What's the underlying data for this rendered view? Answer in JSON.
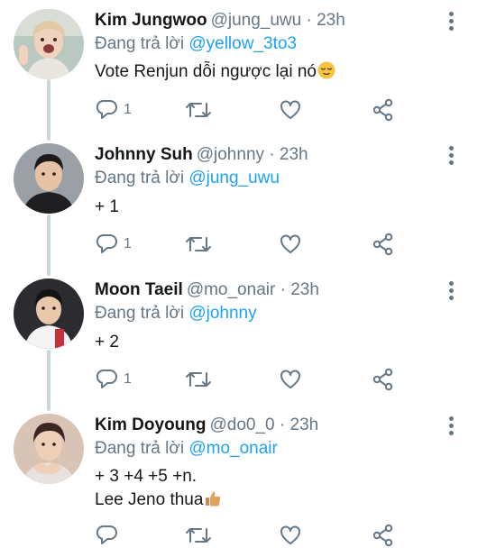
{
  "reply_prefix": "Đang trả lời",
  "tweets": [
    {
      "name": "Kim Jungwoo",
      "handle": "@jung_uwu",
      "time": "23h",
      "reply_to": "@yellow_3to3",
      "text_lines": [
        "Vote Renjun dỗi ngược lại nó"
      ],
      "emoji": "relieved-face",
      "reply_count": "1"
    },
    {
      "name": "Johnny Suh",
      "handle": "@johnny",
      "time": "23h",
      "reply_to": "@jung_uwu",
      "text_lines": [
        "+ 1"
      ],
      "reply_count": "1"
    },
    {
      "name": "Moon Taeil",
      "handle": "@mo_onair",
      "time": "23h",
      "reply_to": "@johnny",
      "text_lines": [
        "+ 2"
      ],
      "reply_count": "1"
    },
    {
      "name": "Kim Doyoung",
      "handle": "@do0_0",
      "time": "23h",
      "reply_to": "@mo_onair",
      "text_lines": [
        "+ 3 +4 +5 +n.",
        "Lee Jeno thua"
      ],
      "emoji": "thumbs-up",
      "reply_count": ""
    }
  ],
  "colors": {
    "primary_text": "#14171a",
    "secondary_text": "#657786",
    "link": "#1da1f2",
    "thread_line": "#ccd6dd"
  },
  "icons": [
    "reply-icon",
    "retweet-icon",
    "like-icon",
    "share-icon",
    "more-options-icon"
  ]
}
